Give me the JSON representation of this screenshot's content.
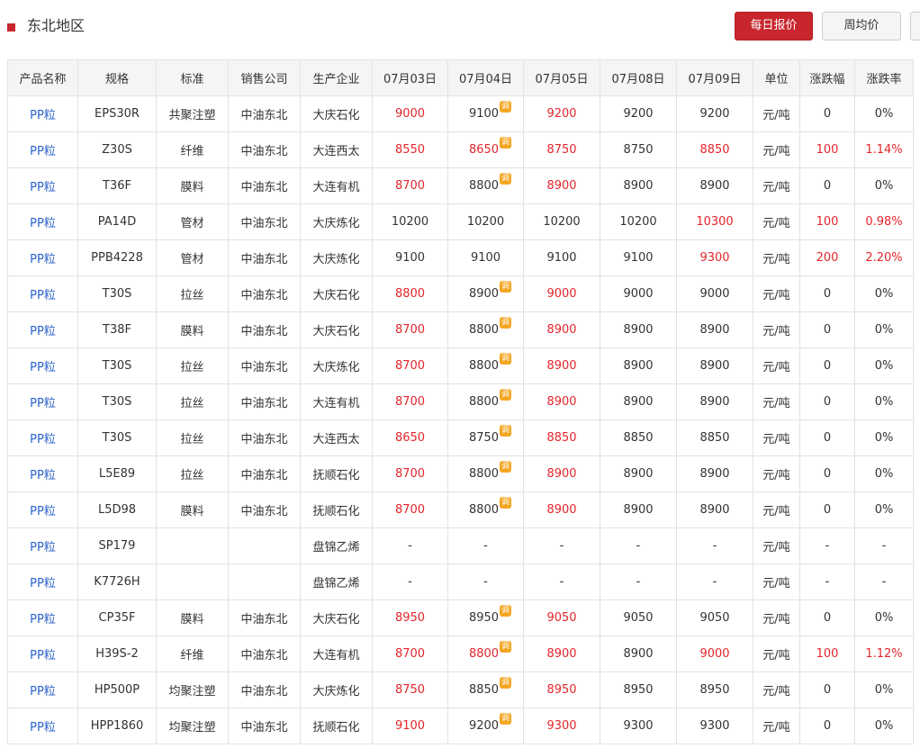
{
  "header": {
    "title": "东北地区",
    "buttons": {
      "daily": "每日报价",
      "weekly": "周均价"
    }
  },
  "colors": {
    "accent": "#c8262c",
    "link": "#2a62c9",
    "up": "#e5262b",
    "badge": "#f5a623"
  },
  "table": {
    "columns": [
      "产品名称",
      "规格",
      "标准",
      "销售公司",
      "生产企业",
      "07月03日",
      "07月04日",
      "07月05日",
      "07月08日",
      "07月09日",
      "单位",
      "涨跌幅",
      "涨跌率"
    ],
    "badge_label": "调",
    "rows": [
      {
        "product": "PP粒",
        "spec": "EPS30R",
        "standard": "共聚注塑",
        "seller": "中油东北",
        "producer": "大庆石化",
        "prices": [
          {
            "v": "9000",
            "up": true
          },
          {
            "v": "9100",
            "badge": true
          },
          {
            "v": "9200",
            "up": true
          },
          {
            "v": "9200"
          },
          {
            "v": "9200"
          }
        ],
        "unit": "元/吨",
        "change": {
          "v": "0"
        },
        "rate": {
          "v": "0%"
        }
      },
      {
        "product": "PP粒",
        "spec": "Z30S",
        "standard": "纤维",
        "seller": "中油东北",
        "producer": "大连西太",
        "prices": [
          {
            "v": "8550",
            "up": true
          },
          {
            "v": "8650",
            "up": true,
            "badge": true
          },
          {
            "v": "8750",
            "up": true
          },
          {
            "v": "8750"
          },
          {
            "v": "8850",
            "up": true
          }
        ],
        "unit": "元/吨",
        "change": {
          "v": "100",
          "up": true
        },
        "rate": {
          "v": "1.14%",
          "up": true
        }
      },
      {
        "product": "PP粒",
        "spec": "T36F",
        "standard": "膜料",
        "seller": "中油东北",
        "producer": "大连有机",
        "prices": [
          {
            "v": "8700",
            "up": true
          },
          {
            "v": "8800",
            "badge": true
          },
          {
            "v": "8900",
            "up": true
          },
          {
            "v": "8900"
          },
          {
            "v": "8900"
          }
        ],
        "unit": "元/吨",
        "change": {
          "v": "0"
        },
        "rate": {
          "v": "0%"
        }
      },
      {
        "product": "PP粒",
        "spec": "PA14D",
        "standard": "管材",
        "seller": "中油东北",
        "producer": "大庆炼化",
        "prices": [
          {
            "v": "10200"
          },
          {
            "v": "10200"
          },
          {
            "v": "10200"
          },
          {
            "v": "10200"
          },
          {
            "v": "10300",
            "up": true
          }
        ],
        "unit": "元/吨",
        "change": {
          "v": "100",
          "up": true
        },
        "rate": {
          "v": "0.98%",
          "up": true
        }
      },
      {
        "product": "PP粒",
        "spec": "PPB4228",
        "standard": "管材",
        "seller": "中油东北",
        "producer": "大庆炼化",
        "prices": [
          {
            "v": "9100"
          },
          {
            "v": "9100"
          },
          {
            "v": "9100"
          },
          {
            "v": "9100"
          },
          {
            "v": "9300",
            "up": true
          }
        ],
        "unit": "元/吨",
        "change": {
          "v": "200",
          "up": true
        },
        "rate": {
          "v": "2.20%",
          "up": true
        }
      },
      {
        "product": "PP粒",
        "spec": "T30S",
        "standard": "拉丝",
        "seller": "中油东北",
        "producer": "大庆石化",
        "prices": [
          {
            "v": "8800",
            "up": true
          },
          {
            "v": "8900",
            "badge": true
          },
          {
            "v": "9000",
            "up": true
          },
          {
            "v": "9000"
          },
          {
            "v": "9000"
          }
        ],
        "unit": "元/吨",
        "change": {
          "v": "0"
        },
        "rate": {
          "v": "0%"
        }
      },
      {
        "product": "PP粒",
        "spec": "T38F",
        "standard": "膜料",
        "seller": "中油东北",
        "producer": "大庆石化",
        "prices": [
          {
            "v": "8700",
            "up": true
          },
          {
            "v": "8800",
            "badge": true
          },
          {
            "v": "8900",
            "up": true
          },
          {
            "v": "8900"
          },
          {
            "v": "8900"
          }
        ],
        "unit": "元/吨",
        "change": {
          "v": "0"
        },
        "rate": {
          "v": "0%"
        }
      },
      {
        "product": "PP粒",
        "spec": "T30S",
        "standard": "拉丝",
        "seller": "中油东北",
        "producer": "大庆炼化",
        "prices": [
          {
            "v": "8700",
            "up": true
          },
          {
            "v": "8800",
            "badge": true
          },
          {
            "v": "8900",
            "up": true
          },
          {
            "v": "8900"
          },
          {
            "v": "8900"
          }
        ],
        "unit": "元/吨",
        "change": {
          "v": "0"
        },
        "rate": {
          "v": "0%"
        }
      },
      {
        "product": "PP粒",
        "spec": "T30S",
        "standard": "拉丝",
        "seller": "中油东北",
        "producer": "大连有机",
        "prices": [
          {
            "v": "8700",
            "up": true
          },
          {
            "v": "8800",
            "badge": true
          },
          {
            "v": "8900",
            "up": true
          },
          {
            "v": "8900"
          },
          {
            "v": "8900"
          }
        ],
        "unit": "元/吨",
        "change": {
          "v": "0"
        },
        "rate": {
          "v": "0%"
        }
      },
      {
        "product": "PP粒",
        "spec": "T30S",
        "standard": "拉丝",
        "seller": "中油东北",
        "producer": "大连西太",
        "prices": [
          {
            "v": "8650",
            "up": true
          },
          {
            "v": "8750",
            "badge": true
          },
          {
            "v": "8850",
            "up": true
          },
          {
            "v": "8850"
          },
          {
            "v": "8850"
          }
        ],
        "unit": "元/吨",
        "change": {
          "v": "0"
        },
        "rate": {
          "v": "0%"
        }
      },
      {
        "product": "PP粒",
        "spec": "L5E89",
        "standard": "拉丝",
        "seller": "中油东北",
        "producer": "抚顺石化",
        "prices": [
          {
            "v": "8700",
            "up": true
          },
          {
            "v": "8800",
            "badge": true
          },
          {
            "v": "8900",
            "up": true
          },
          {
            "v": "8900"
          },
          {
            "v": "8900"
          }
        ],
        "unit": "元/吨",
        "change": {
          "v": "0"
        },
        "rate": {
          "v": "0%"
        }
      },
      {
        "product": "PP粒",
        "spec": "L5D98",
        "standard": "膜料",
        "seller": "中油东北",
        "producer": "抚顺石化",
        "prices": [
          {
            "v": "8700",
            "up": true
          },
          {
            "v": "8800",
            "badge": true
          },
          {
            "v": "8900",
            "up": true
          },
          {
            "v": "8900"
          },
          {
            "v": "8900"
          }
        ],
        "unit": "元/吨",
        "change": {
          "v": "0"
        },
        "rate": {
          "v": "0%"
        }
      },
      {
        "product": "PP粒",
        "spec": "SP179",
        "standard": "",
        "seller": "",
        "producer": "盘锦乙烯",
        "prices": [
          {
            "v": "-"
          },
          {
            "v": "-"
          },
          {
            "v": "-"
          },
          {
            "v": "-"
          },
          {
            "v": "-"
          }
        ],
        "unit": "元/吨",
        "change": {
          "v": "-"
        },
        "rate": {
          "v": "-"
        }
      },
      {
        "product": "PP粒",
        "spec": "K7726H",
        "standard": "",
        "seller": "",
        "producer": "盘锦乙烯",
        "prices": [
          {
            "v": "-"
          },
          {
            "v": "-"
          },
          {
            "v": "-"
          },
          {
            "v": "-"
          },
          {
            "v": "-"
          }
        ],
        "unit": "元/吨",
        "change": {
          "v": "-"
        },
        "rate": {
          "v": "-"
        }
      },
      {
        "product": "PP粒",
        "spec": "CP35F",
        "standard": "膜料",
        "seller": "中油东北",
        "producer": "大庆石化",
        "prices": [
          {
            "v": "8950",
            "up": true
          },
          {
            "v": "8950",
            "badge": true
          },
          {
            "v": "9050",
            "up": true
          },
          {
            "v": "9050"
          },
          {
            "v": "9050"
          }
        ],
        "unit": "元/吨",
        "change": {
          "v": "0"
        },
        "rate": {
          "v": "0%"
        }
      },
      {
        "product": "PP粒",
        "spec": "H39S-2",
        "standard": "纤维",
        "seller": "中油东北",
        "producer": "大连有机",
        "prices": [
          {
            "v": "8700",
            "up": true
          },
          {
            "v": "8800",
            "up": true,
            "badge": true
          },
          {
            "v": "8900",
            "up": true
          },
          {
            "v": "8900"
          },
          {
            "v": "9000",
            "up": true
          }
        ],
        "unit": "元/吨",
        "change": {
          "v": "100",
          "up": true
        },
        "rate": {
          "v": "1.12%",
          "up": true
        }
      },
      {
        "product": "PP粒",
        "spec": "HP500P",
        "standard": "均聚注塑",
        "seller": "中油东北",
        "producer": "大庆炼化",
        "prices": [
          {
            "v": "8750",
            "up": true
          },
          {
            "v": "8850",
            "badge": true
          },
          {
            "v": "8950",
            "up": true
          },
          {
            "v": "8950"
          },
          {
            "v": "8950"
          }
        ],
        "unit": "元/吨",
        "change": {
          "v": "0"
        },
        "rate": {
          "v": "0%"
        }
      },
      {
        "product": "PP粒",
        "spec": "HPP1860",
        "standard": "均聚注塑",
        "seller": "中油东北",
        "producer": "抚顺石化",
        "prices": [
          {
            "v": "9100",
            "up": true
          },
          {
            "v": "9200",
            "badge": true
          },
          {
            "v": "9300",
            "up": true
          },
          {
            "v": "9300"
          },
          {
            "v": "9300"
          }
        ],
        "unit": "元/吨",
        "change": {
          "v": "0"
        },
        "rate": {
          "v": "0%"
        }
      }
    ]
  }
}
